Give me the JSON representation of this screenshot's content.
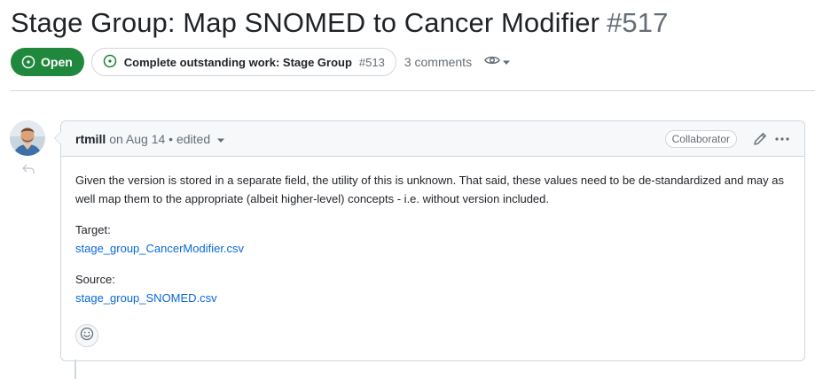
{
  "issue": {
    "title": "Stage Group: Map SNOMED to Cancer Modifier",
    "number": "#517",
    "state": "Open",
    "state_icon": "issue-opened-icon",
    "tracked_in": {
      "label": "Complete outstanding work: Stage Group",
      "number": "#513"
    },
    "comments_count": "3 comments",
    "watch_icon": "eye-icon"
  },
  "comment": {
    "author": "rtmill",
    "posted": "on Aug 14 • edited",
    "role": "Collaborator",
    "body": "Given the version is stored in a separate field, the utility of this is unknown. That said, these values need to be de-standardized and may as well map them to the appropriate (albeit higher-level) concepts - i.e. without version included.",
    "target_label": "Target:",
    "target_link": "stage_group_CancerModifier.csv",
    "source_label": "Source:",
    "source_link": "stage_group_SNOMED.csv"
  },
  "colors": {
    "open_green": "#1f883d",
    "link_blue": "#0969da",
    "muted": "#656d76",
    "border": "#d0d7de"
  }
}
